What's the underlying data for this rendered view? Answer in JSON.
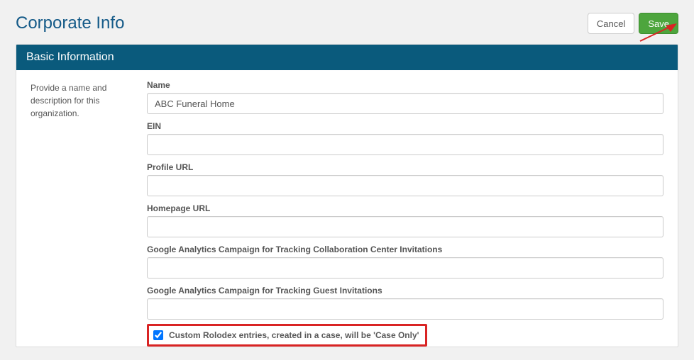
{
  "page": {
    "title": "Corporate Info"
  },
  "header": {
    "cancel_label": "Cancel",
    "save_label": "Save"
  },
  "panel": {
    "heading": "Basic Information",
    "side_text": "Provide a name and description for this organization."
  },
  "form": {
    "name": {
      "label": "Name",
      "value": "ABC Funeral Home"
    },
    "ein": {
      "label": "EIN",
      "value": ""
    },
    "profile_url": {
      "label": "Profile URL",
      "value": ""
    },
    "homepage_url": {
      "label": "Homepage URL",
      "value": ""
    },
    "ga_collab": {
      "label": "Google Analytics Campaign for Tracking Collaboration Center Invitations",
      "value": ""
    },
    "ga_guest": {
      "label": "Google Analytics Campaign for Tracking Guest Invitations",
      "value": ""
    },
    "rolodex_checkbox": {
      "label": "Custom Rolodex entries, created in a case, will be 'Case Only'",
      "checked": true
    }
  },
  "colors": {
    "accent_teal": "#0a5a7c",
    "title_blue": "#135c8c",
    "success_green": "#4da53d",
    "highlight_red": "#d92424"
  }
}
